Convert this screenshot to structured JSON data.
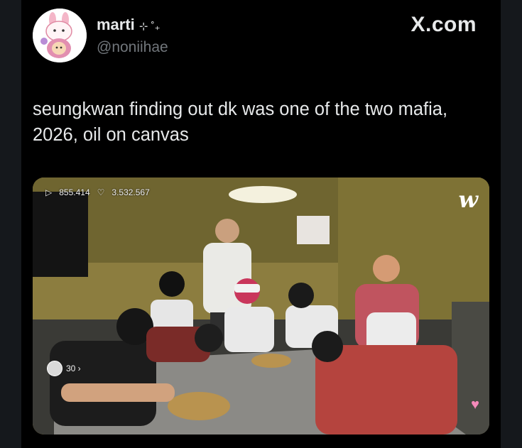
{
  "tweet": {
    "display_name": "marti",
    "name_decoration": "⊹ ˚₊",
    "handle": "@noniihae",
    "site_label": "X.com",
    "text": "seungkwan finding out dk was one of the two mafia, 2026, oil on canvas"
  },
  "media": {
    "views_icon": "play-icon",
    "views": "855.414",
    "likes_icon": "heart-outline-icon",
    "likes": "3.532.567",
    "app_logo": "w",
    "viewer_count": "30 ›",
    "reaction_icon": "heart-icon"
  },
  "colors": {
    "background": "#000000",
    "text_primary": "#e7e9ea",
    "text_secondary": "#71767b",
    "wall": "#8c7d3f"
  }
}
